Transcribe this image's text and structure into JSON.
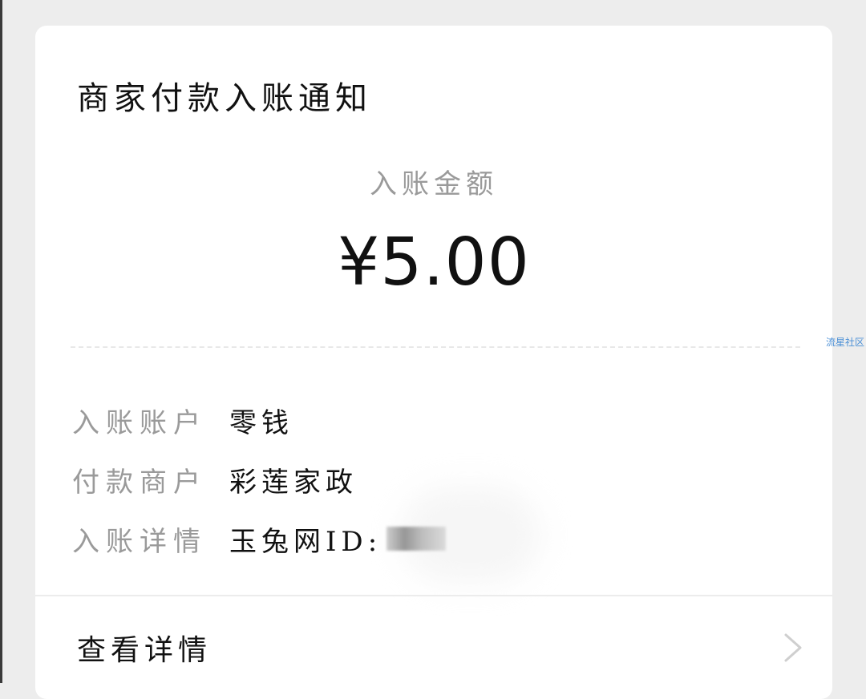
{
  "card": {
    "title": "商家付款入账通知",
    "amount_label": "入账金额",
    "amount_value": "¥5.00",
    "rows": [
      {
        "label": "入账账户",
        "value": "零钱"
      },
      {
        "label": "付款商户",
        "value": "彩莲家政"
      },
      {
        "label": "入账详情",
        "value": "玉兔网ID:"
      }
    ],
    "detail_link_label": "查看详情"
  },
  "watermark": "流星社区",
  "icons": {
    "detail_chevron": "chevron-right-icon"
  }
}
